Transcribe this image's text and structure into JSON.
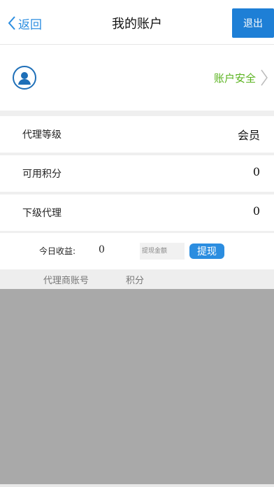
{
  "navbar": {
    "back_label": "返回",
    "title": "我的账户",
    "logout_label": "退出"
  },
  "profile": {
    "security_label": "账户安全"
  },
  "info": {
    "level_label": "代理等级",
    "level_value": "会员",
    "points_label": "可用积分",
    "points_value": "0",
    "subagent_label": "下级代理",
    "subagent_value": "0"
  },
  "earnings": {
    "today_label": "今日收益:",
    "today_value": "0",
    "withdraw_placeholder": "提现金额",
    "withdraw_button": "提现"
  },
  "table": {
    "columns": [
      "代理商账号",
      "积分"
    ]
  },
  "colors": {
    "accent": "#2b8de0",
    "logout_bg": "#1e7fd6",
    "security_green": "#5ab31f",
    "list_bg": "#a9a9a9"
  },
  "icons": {
    "back": "chevron-left-icon",
    "avatar": "user-avatar-icon",
    "security": "chevron-right-icon"
  }
}
